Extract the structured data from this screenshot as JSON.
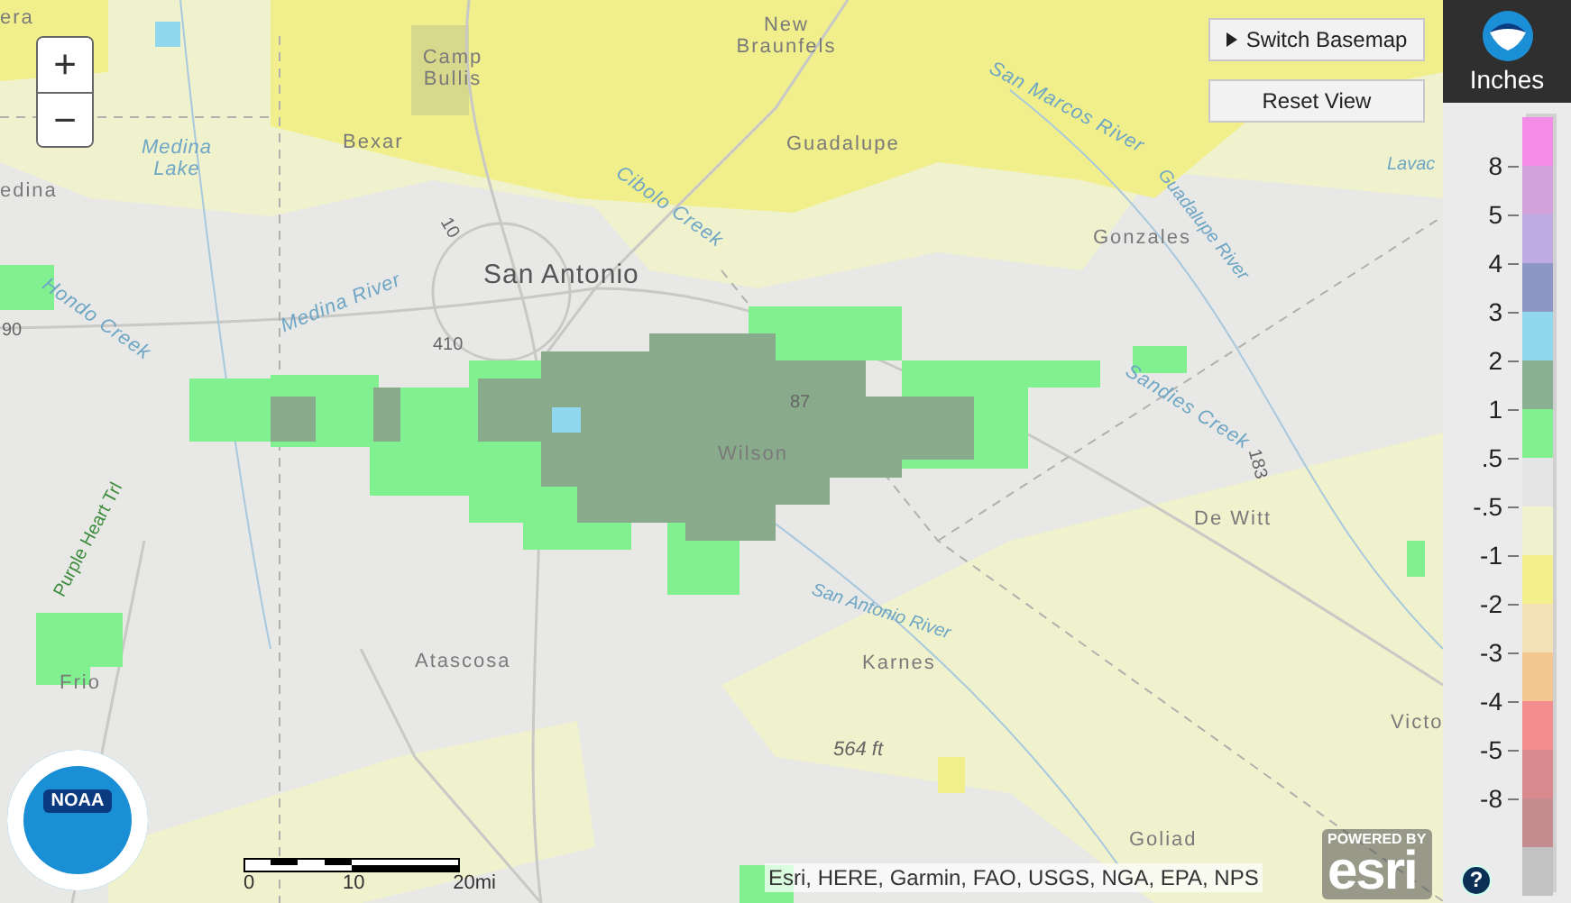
{
  "map": {
    "labels": [
      {
        "text": "era",
        "kind": "place"
      },
      {
        "text": "New Braunfels",
        "kind": "place"
      },
      {
        "text": "Camp Bullis",
        "kind": "place"
      },
      {
        "text": "Medina Lake",
        "kind": "water"
      },
      {
        "text": "Bexar",
        "kind": "place"
      },
      {
        "text": "Guadalupe",
        "kind": "place"
      },
      {
        "text": "San Marcos River",
        "kind": "water"
      },
      {
        "text": "Cibolo Creek",
        "kind": "water"
      },
      {
        "text": "Lavac",
        "kind": "water"
      },
      {
        "text": "edina",
        "kind": "place"
      },
      {
        "text": "Guadalupe River",
        "kind": "water"
      },
      {
        "text": "10",
        "kind": "road"
      },
      {
        "text": "Gonzales",
        "kind": "place"
      },
      {
        "text": "San Antonio",
        "kind": "city"
      },
      {
        "text": "Hondo Creek",
        "kind": "water"
      },
      {
        "text": "90",
        "kind": "road"
      },
      {
        "text": "Medina River",
        "kind": "water"
      },
      {
        "text": "410",
        "kind": "road"
      },
      {
        "text": "Sandies Creek",
        "kind": "water"
      },
      {
        "text": "87",
        "kind": "road"
      },
      {
        "text": "183",
        "kind": "road"
      },
      {
        "text": "Wilson",
        "kind": "place"
      },
      {
        "text": "De Witt",
        "kind": "place"
      },
      {
        "text": "Purple Heart Trl",
        "kind": "trail"
      },
      {
        "text": "San Antonio River",
        "kind": "water"
      },
      {
        "text": "Frio",
        "kind": "place"
      },
      {
        "text": "Atascosa",
        "kind": "place"
      },
      {
        "text": "Karnes",
        "kind": "place"
      },
      {
        "text": "Victo",
        "kind": "place"
      },
      {
        "text": "564 ft",
        "kind": "elevation"
      },
      {
        "text": "Goliad",
        "kind": "place"
      }
    ]
  },
  "zoom": {
    "in": "+",
    "out": "−"
  },
  "buttons": {
    "switch_basemap": "Switch Basemap",
    "reset_view": "Reset View"
  },
  "scale_bar": {
    "ticks": [
      "0",
      "10",
      "20mi"
    ]
  },
  "attribution": "Esri, HERE, Garmin, FAO, USGS, NGA, EPA, NPS",
  "esri_logo": {
    "tagline": "POWERED BY",
    "name": "esri"
  },
  "noaa_logo": {
    "name": "NOAA"
  },
  "legend": {
    "unit": "Inches",
    "swatches": [
      {
        "color": "#f58ce8"
      },
      {
        "color": "#d4a3dd"
      },
      {
        "color": "#bfabe2"
      },
      {
        "color": "#8e96c6"
      },
      {
        "color": "#90d8ee"
      },
      {
        "color": "#89b092"
      },
      {
        "color": "#80f090"
      },
      {
        "color": "#e4e4e4"
      },
      {
        "color": "#eff2cd"
      },
      {
        "color": "#f3ef8c"
      },
      {
        "color": "#f3e0b4"
      },
      {
        "color": "#f4c690"
      },
      {
        "color": "#f48e8e"
      },
      {
        "color": "#d88a8e"
      },
      {
        "color": "#c48c8e"
      },
      {
        "color": "#c2c2c2"
      }
    ],
    "labels": [
      "8",
      "5",
      "4",
      "3",
      "2",
      "1",
      ".5",
      "-.5",
      "-1",
      "-2",
      "-3",
      "-4",
      "-5",
      "-8"
    ],
    "help": "?"
  }
}
